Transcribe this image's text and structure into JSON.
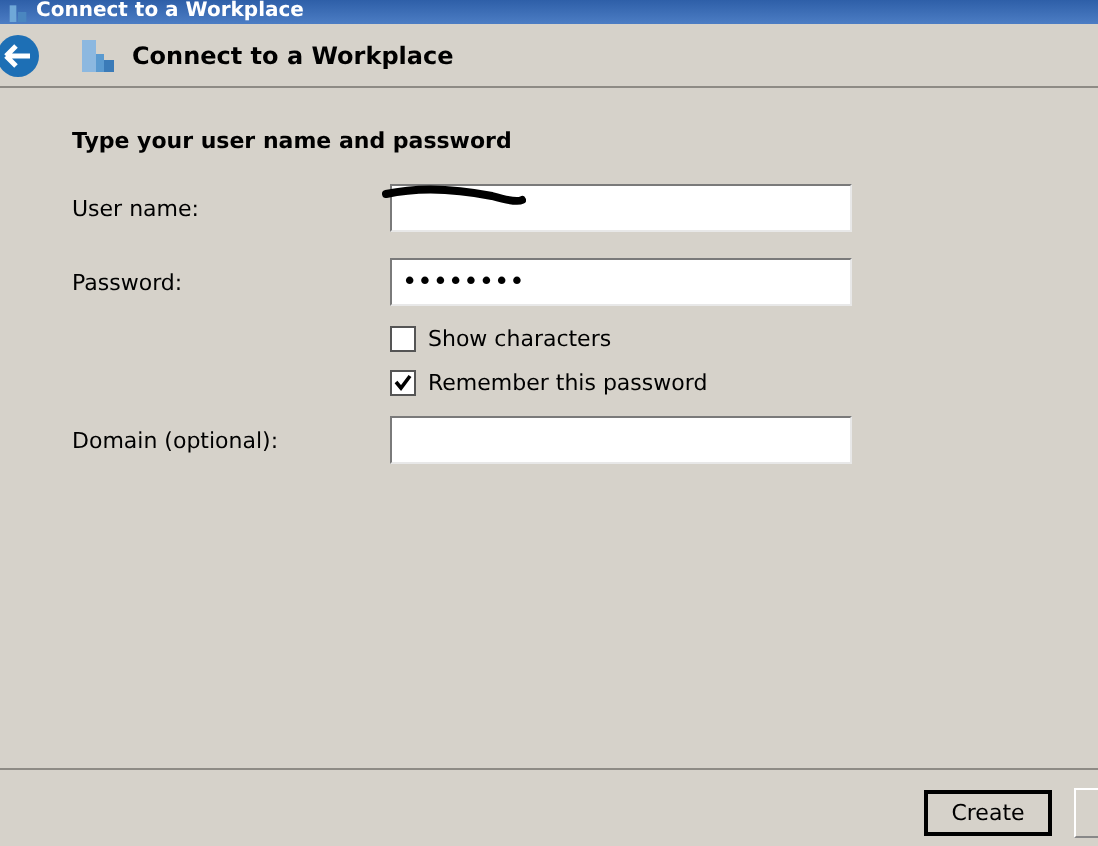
{
  "window": {
    "title": "Connect to a Workplace"
  },
  "header": {
    "title": "Connect to a Workplace"
  },
  "heading": "Type your user name and password",
  "fields": [
    {
      "kind": "text",
      "label": "User name:",
      "redacted": true
    },
    {
      "kind": "password",
      "label": "Password:",
      "value": "••••••••",
      "redacted": false
    }
  ],
  "options": [
    {
      "label": "Show characters",
      "checked": false
    },
    {
      "label": "Remember this password",
      "checked": true
    }
  ],
  "domain": {
    "label": "Domain (optional):"
  },
  "buttons": [
    {
      "label": "Create",
      "default": true
    }
  ]
}
